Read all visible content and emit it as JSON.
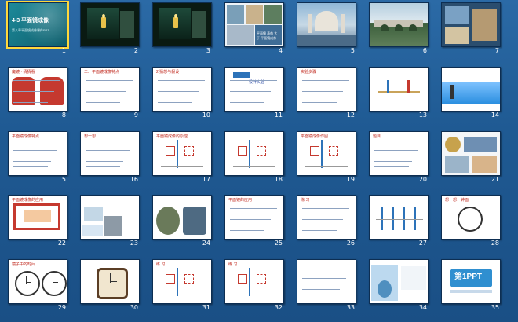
{
  "window": {
    "view": "slide-sorter"
  },
  "slides": [
    {
      "num": "1",
      "kind": "title",
      "text": "4-3 平面镜成像",
      "sub": "第八章平面镜成像课件PPT"
    },
    {
      "num": "2",
      "kind": "dark-photo",
      "text": ""
    },
    {
      "num": "3",
      "kind": "dark-photo",
      "text": ""
    },
    {
      "num": "4",
      "kind": "photo-collage",
      "text": "平面镜 表像 大于 平面镜成像"
    },
    {
      "num": "5",
      "kind": "photo",
      "text": ""
    },
    {
      "num": "6",
      "kind": "photo",
      "text": ""
    },
    {
      "num": "7",
      "kind": "photo",
      "text": ""
    },
    {
      "num": "8",
      "kind": "text",
      "text": "魔镜 · 猜猜看"
    },
    {
      "num": "9",
      "kind": "text",
      "text": "二、平面镜成像特点"
    },
    {
      "num": "10",
      "kind": "text",
      "text": "2.猜想与假设"
    },
    {
      "num": "11",
      "kind": "text",
      "text": "设计实验"
    },
    {
      "num": "12",
      "kind": "text",
      "text": "实验步骤"
    },
    {
      "num": "13",
      "kind": "diagram",
      "text": ""
    },
    {
      "num": "14",
      "kind": "diagram",
      "text": ""
    },
    {
      "num": "15",
      "kind": "text",
      "text": "平面镜成像特点"
    },
    {
      "num": "16",
      "kind": "text",
      "text": "想一想"
    },
    {
      "num": "17",
      "kind": "diagram",
      "text": "平面镜成像的原理"
    },
    {
      "num": "18",
      "kind": "diagram",
      "text": ""
    },
    {
      "num": "19",
      "kind": "diagram",
      "text": "平面镜成像作图"
    },
    {
      "num": "20",
      "kind": "text",
      "text": "题目"
    },
    {
      "num": "21",
      "kind": "photo",
      "text": ""
    },
    {
      "num": "22",
      "kind": "diagram",
      "text": "平面镜成像的应用"
    },
    {
      "num": "23",
      "kind": "photo",
      "text": ""
    },
    {
      "num": "24",
      "kind": "photo",
      "text": ""
    },
    {
      "num": "25",
      "kind": "text",
      "text": "平面镜的应用"
    },
    {
      "num": "26",
      "kind": "text",
      "text": "练 习"
    },
    {
      "num": "27",
      "kind": "diagram",
      "text": ""
    },
    {
      "num": "28",
      "kind": "clock",
      "text": "想一想：钟面"
    },
    {
      "num": "29",
      "kind": "clock",
      "text": "镜子中的时间"
    },
    {
      "num": "30",
      "kind": "clock",
      "text": ""
    },
    {
      "num": "31",
      "kind": "diagram",
      "text": "练 习"
    },
    {
      "num": "32",
      "kind": "diagram",
      "text": "练 习"
    },
    {
      "num": "33",
      "kind": "text",
      "text": ""
    },
    {
      "num": "34",
      "kind": "photo",
      "text": ""
    },
    {
      "num": "35",
      "kind": "logo",
      "text": "第1PPT"
    }
  ]
}
